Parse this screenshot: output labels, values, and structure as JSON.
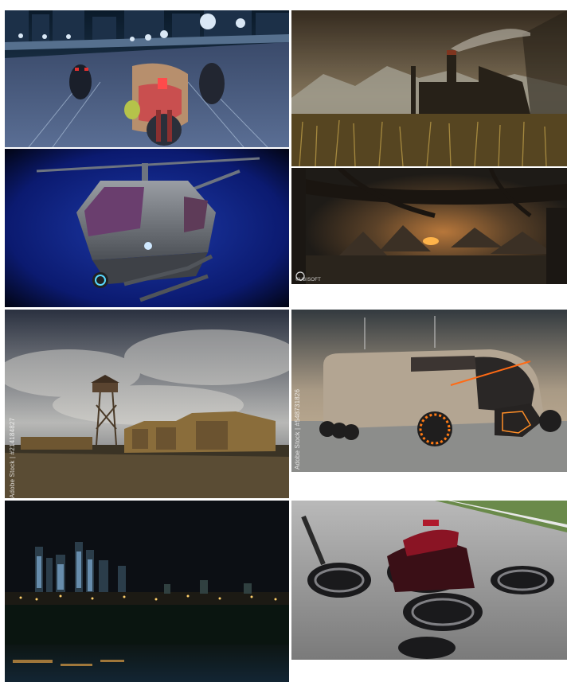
{
  "gallery": {
    "tiles": [
      {
        "subject": "anime motorcycle chase at night"
      },
      {
        "subject": "industrial ruins with smokestacks"
      },
      {
        "subject": "futuristic helicopter drone"
      },
      {
        "subject": "camp under fallen trees",
        "watermark": "©UBISOFT"
      },
      {
        "subject": "watchtower and old wagons at night",
        "watermark": "Adobe Stock | #214184827"
      },
      {
        "subject": "futuristic armored truck",
        "watermark": "Adobe Stock | #548731826"
      },
      {
        "subject": "city skyline at night"
      },
      {
        "subject": "hoverbike on asphalt"
      }
    ]
  }
}
